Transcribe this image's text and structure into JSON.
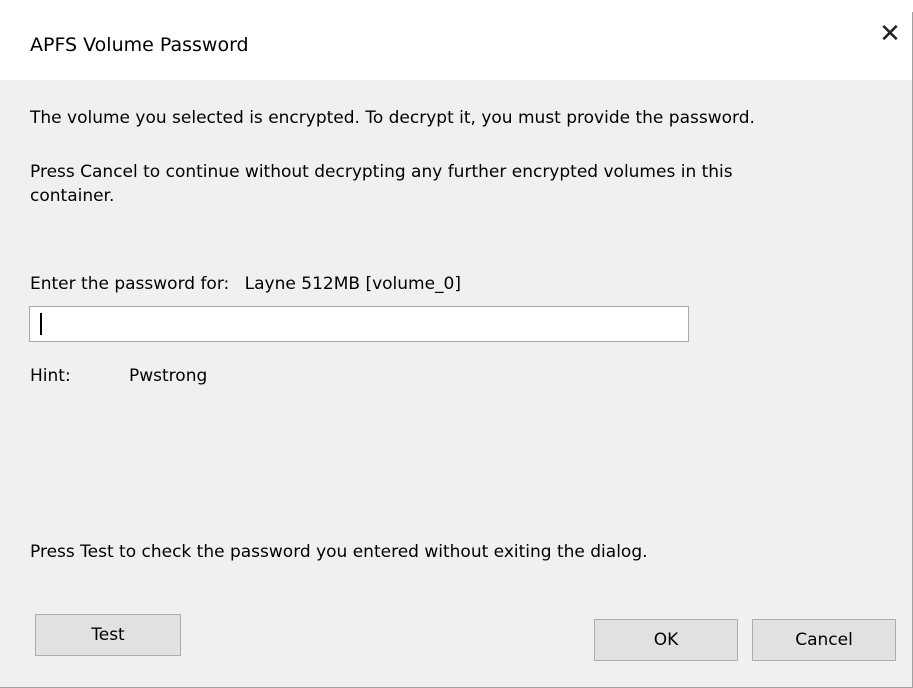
{
  "dialog": {
    "title": "APFS Volume Password",
    "close_icon": "close-icon"
  },
  "message": {
    "line1": "The volume you selected is encrypted. To decrypt it, you must provide the password.",
    "line2": "Press Cancel to continue without decrypting any further encrypted volumes in this container."
  },
  "password": {
    "label": "Enter the password for:",
    "volume_name": "Layne 512MB [volume_0]",
    "value": "",
    "placeholder": ""
  },
  "hint": {
    "label": "Hint:",
    "value": "Pwstrong"
  },
  "footer": {
    "test_instruction": "Press Test to check the password you entered without exiting the dialog."
  },
  "buttons": {
    "test": "Test",
    "ok": "OK",
    "cancel": "Cancel"
  }
}
